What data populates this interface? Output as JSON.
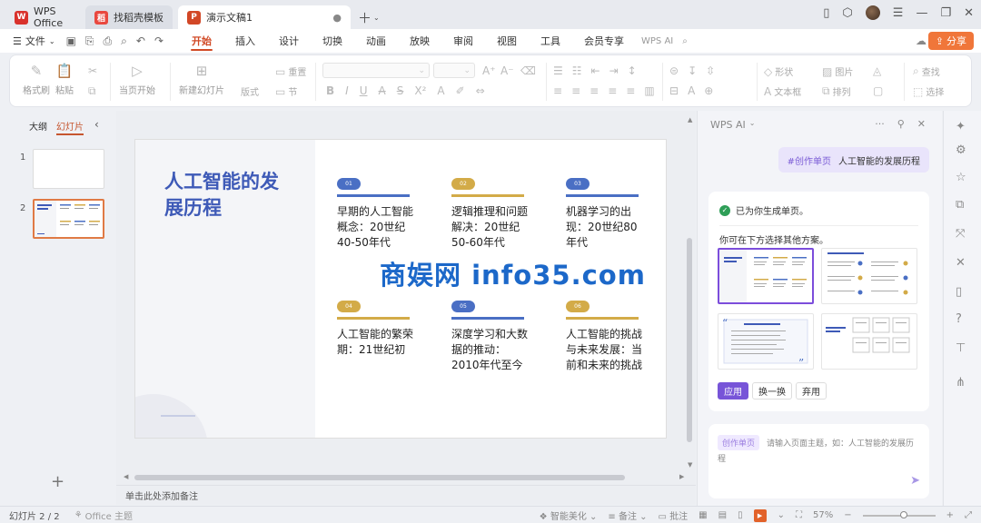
{
  "titlebar": {
    "tabs": [
      {
        "label": "WPS Office",
        "logo": "W",
        "color": "#d9322c"
      },
      {
        "label": "找稻壳模板",
        "logo": "稻",
        "color": "#e9483f"
      },
      {
        "label": "演示文稿1",
        "logo": "P",
        "color": "#d24726"
      }
    ]
  },
  "menubar": {
    "file": "文件",
    "tabs": [
      "开始",
      "插入",
      "设计",
      "切换",
      "动画",
      "放映",
      "审阅",
      "视图",
      "工具",
      "会员专享"
    ],
    "active_tab": "开始",
    "wps_ai": "WPS AI",
    "share": "分享"
  },
  "ribbon": {
    "format_painter": "格式刷",
    "paste": "粘贴",
    "from_current": "当页开始",
    "new_slide": "新建幻灯片",
    "layout": "版式",
    "section": "节",
    "reset": "重置",
    "shape": "形状",
    "image": "图片",
    "textbox": "文本框",
    "arrange": "排列",
    "find": "查找",
    "select": "选择"
  },
  "leftpanel": {
    "outline_tab": "大纲",
    "slides_tab": "幻灯片",
    "slide_numbers": [
      "1",
      "2"
    ],
    "add": "+"
  },
  "slide": {
    "title": "人工智能的发展历程",
    "items": [
      {
        "num": "01",
        "text": "早期的人工智能概念：20世纪40-50年代",
        "color": "#4a6fc4"
      },
      {
        "num": "02",
        "text": "逻辑推理和问题解决：20世纪50-60年代",
        "color": "#d3ab48"
      },
      {
        "num": "03",
        "text": "机器学习的出现：20世纪80年代",
        "color": "#4a6fc4"
      },
      {
        "num": "04",
        "text": "人工智能的繁荣期：21世纪初",
        "color": "#d3ab48"
      },
      {
        "num": "05",
        "text": "深度学习和大数据的推动：2010年代至今",
        "color": "#4a6fc4"
      },
      {
        "num": "06",
        "text": "人工智能的挑战与未来发展：当前和未来的挑战",
        "color": "#d3ab48"
      }
    ]
  },
  "notes": {
    "placeholder": "单击此处添加备注"
  },
  "ai": {
    "header": "WPS AI",
    "user_tag": "#创作单页",
    "user_text": "人工智能的发展历程",
    "done": "已为你生成单页。",
    "hint": "你可在下方选择其他方案。",
    "apply": "应用",
    "change": "换一换",
    "discard": "弃用",
    "input_tag": "创作单页",
    "input_placeholder": "请输入页面主题，如：人工智能的发展历程"
  },
  "status": {
    "slide_count": "幻灯片 2 / 2",
    "theme": "Office 主题",
    "beautify": "智能美化",
    "notes": "备注",
    "comments": "批注",
    "zoom": "57%",
    "zoom_level": 0.57
  },
  "watermark": "商娱网 info35.com"
}
